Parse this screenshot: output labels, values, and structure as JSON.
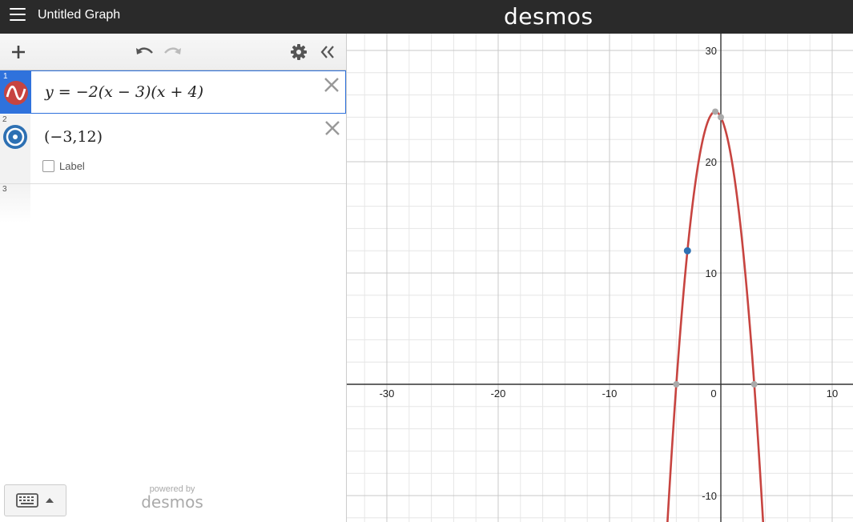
{
  "header": {
    "menu_icon": "hamburger-icon",
    "title": "Untitled Graph",
    "brand": "desmos"
  },
  "toolbar": {
    "add_icon": "plus-icon",
    "undo_icon": "undo-icon",
    "redo_icon": "redo-icon",
    "settings_icon": "gear-icon",
    "collapse_icon": "double-chevron-left-icon"
  },
  "expressions": [
    {
      "index": "1",
      "latex": "y = −2(x − 3)(x + 4)",
      "color": "#c74440",
      "type": "function"
    },
    {
      "index": "2",
      "latex": "(−3,12)",
      "color": "#2d70b3",
      "type": "point",
      "label_text": "Label",
      "label_checked": false
    },
    {
      "index": "3",
      "latex": "",
      "type": "empty"
    }
  ],
  "footer": {
    "keyboard_icon": "keyboard-icon",
    "powered_by": "powered by",
    "powered_brand": "desmos"
  },
  "graph": {
    "x_ticks": [
      "-30",
      "-20",
      "-10",
      "0",
      "10"
    ],
    "y_ticks": [
      "30",
      "20",
      "10",
      "-10"
    ],
    "curve_color": "#c74440",
    "point_color": "#2d70b3",
    "key_point_color": "#aaaaaa"
  }
}
